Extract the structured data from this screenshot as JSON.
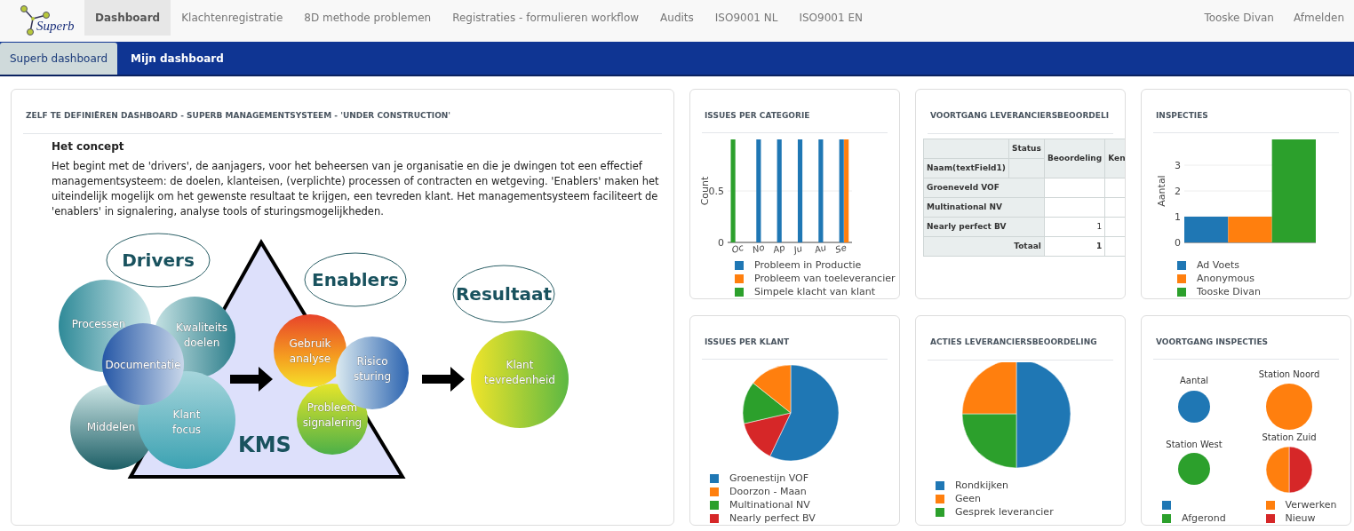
{
  "nav": {
    "logo_text": "Superb",
    "items": [
      {
        "label": "Dashboard",
        "selected": true
      },
      {
        "label": "Klachtenregistratie",
        "selected": false
      },
      {
        "label": "8D methode problemen",
        "selected": false
      },
      {
        "label": "Registraties - formulieren workflow",
        "selected": false
      },
      {
        "label": "Audits",
        "selected": false
      },
      {
        "label": "ISO9001 NL",
        "selected": false
      },
      {
        "label": "ISO9001 EN",
        "selected": false
      }
    ],
    "user": "Tooske Divan",
    "logout": "Afmelden"
  },
  "subtabs": [
    {
      "label": "Superb dashboard",
      "selected": true
    },
    {
      "label": "Mijn dashboard",
      "selected": false
    }
  ],
  "intro_card": {
    "title": "ZELF TE DEFINIËREN DASHBOARD - SUPERB MANAGEMENTSYSTEEM - 'UNDER CONSTRUCTION'",
    "heading": "Het concept",
    "paragraph": "Het begint met de 'drivers', de aanjagers, voor het beheersen van je organisatie en die je dwingen tot een effectief managementsysteem: de doelen, klanteisen, (verplichte) processen of contracten en wetgeving. 'Enablers' maken het uiteindelijk mogelijk om het gewenste resultaat te krijgen, een tevreden klant. Het managementsysteem faciliteert de 'enablers' in signalering, analyse tools of sturingsmogelijkheden.",
    "diagram": {
      "group_labels": [
        "Drivers",
        "Enablers",
        "Resultaat"
      ],
      "core_label": "KMS",
      "circles": [
        "Processen",
        "Kwaliteits doelen",
        "Gebruik analyse",
        "Documentatie",
        "Risico sturing",
        "Klant tevredenheid",
        "Middelen",
        "Klant focus",
        "Probleem signalering"
      ]
    }
  },
  "issues_per_categorie": {
    "title": "ISSUES PER CATEGORIE",
    "chart_data": {
      "type": "bar",
      "grid": true,
      "ylabel": "Count",
      "categories": [
        "Oc",
        "No",
        "Ap",
        "Ju",
        "Au",
        "Se"
      ],
      "ylim": [
        0,
        1
      ],
      "yticks": [
        0,
        0.5
      ],
      "series": [
        {
          "name": "Probleem in Productie",
          "color": "#1f77b4",
          "values": [
            0,
            1,
            1,
            1,
            1,
            1
          ]
        },
        {
          "name": "Probleem van toeleverancier",
          "color": "#ff7f0e",
          "values": [
            0,
            0,
            0,
            0,
            0,
            1
          ]
        },
        {
          "name": "Simpele klacht van klant",
          "color": "#2ca02c",
          "values": [
            1,
            0,
            0,
            0,
            0,
            0
          ]
        }
      ]
    }
  },
  "voortgang_leveranciersbeoordeling": {
    "title": "VOORTGANG LEVERANCIERSBEOORDELI",
    "table": {
      "status_label": "Status",
      "row_header_label": "Naam(textField1)",
      "columns": [
        "Beoordeling",
        "Ken"
      ],
      "rows": [
        {
          "name": "Groeneveld VOF"
        },
        {
          "name": "Multinational NV"
        },
        {
          "name": "Nearly perfect BV",
          "cells": [
            "1"
          ]
        }
      ],
      "total": {
        "label": "Totaal",
        "cells": [
          "1"
        ]
      }
    }
  },
  "inspecties": {
    "title": "INSPECTIES",
    "chart_data": {
      "type": "bar",
      "grid": true,
      "ylabel": "Aantal",
      "ylim": [
        0,
        4
      ],
      "yticks": [
        0,
        1,
        2,
        3
      ],
      "series": [
        {
          "name": "Ad Voets",
          "color": "#1f77b4",
          "values": [
            1
          ]
        },
        {
          "name": "Anonymous",
          "color": "#ff7f0e",
          "values": [
            1
          ]
        },
        {
          "name": "Tooske Divan",
          "color": "#2ca02c",
          "values": [
            4
          ]
        }
      ]
    }
  },
  "issues_per_klant": {
    "title": "ISSUES PER KLANT",
    "chart_data": {
      "type": "pie",
      "categories": [
        "Groenestijn VOF",
        "Doorzon - Maan",
        "Multinational NV",
        "Nearly perfect BV"
      ],
      "values": [
        57.1,
        14.3,
        14.3,
        14.3
      ],
      "colors": [
        "#1f77b4",
        "#ff7f0e",
        "#2ca02c",
        "#d62728"
      ]
    }
  },
  "acties_leveranciersbeoordeling": {
    "title": "ACTIES LEVERANCIERSBEOORDELING",
    "chart_data": {
      "type": "pie",
      "categories": [
        "Rondkijken",
        "Geen",
        "Gesprek leverancier"
      ],
      "values": [
        50,
        25,
        25
      ],
      "colors": [
        "#1f77b4",
        "#ff7f0e",
        "#2ca02c"
      ]
    }
  },
  "voortgang_inspecties": {
    "title": "VOORTGANG INSPECTIES",
    "legend": [
      {
        "color": "#1f77b4"
      },
      {
        "color": "#ff7f0e",
        "label": "Verwerken"
      },
      {
        "color": "#2ca02c",
        "label": "Afgerond"
      },
      {
        "color": "#d62728",
        "label": "Nieuw"
      }
    ],
    "pies": [
      {
        "chart_data": {
          "type": "pie",
          "title": "Aantal",
          "values": [
            100,
            0,
            0,
            0
          ]
        }
      },
      {
        "chart_data": {
          "type": "pie",
          "title": "Station Noord",
          "values": [
            0,
            100,
            0,
            0
          ]
        }
      },
      {
        "chart_data": {
          "type": "pie",
          "title": "Station West",
          "values": [
            0,
            0,
            100,
            0
          ]
        }
      },
      {
        "chart_data": {
          "type": "pie",
          "title": "Station Zuid",
          "values": [
            0,
            50,
            0,
            50
          ]
        }
      }
    ]
  }
}
